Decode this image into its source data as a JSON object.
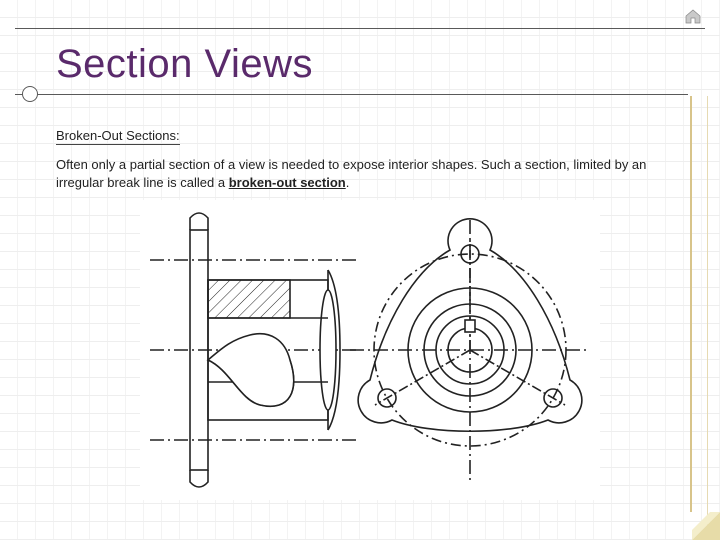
{
  "title": "Section Views",
  "subhead": "Broken-Out Sections:",
  "body": {
    "pre": "Often only a partial section of a view is needed to expose interior shapes.  Such a section, limited by an irregular break line is called a ",
    "bold": "broken-out section",
    "post": "."
  },
  "icons": {
    "home": "home-icon",
    "corner": "page-curl-icon"
  }
}
